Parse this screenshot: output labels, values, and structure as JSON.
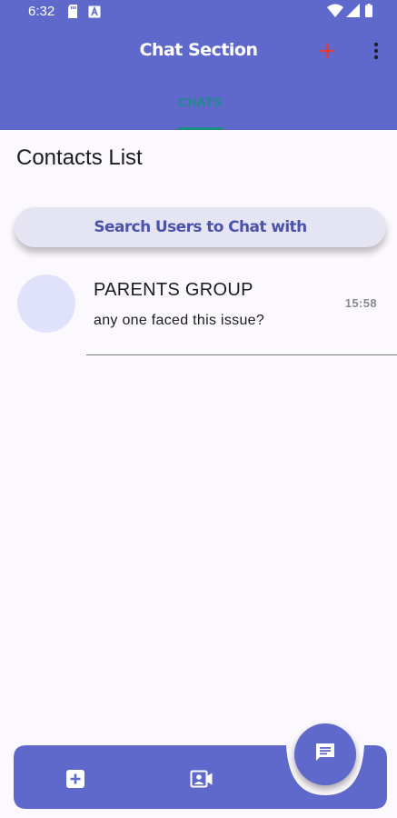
{
  "status_bar": {
    "time": "6:32",
    "icons": [
      "sd-card-icon",
      "keyboard-a-icon",
      "wifi-icon",
      "signal-icon",
      "battery-icon"
    ]
  },
  "app_bar": {
    "title": "Chat Section",
    "actions": [
      "add-icon",
      "more-vert-icon"
    ],
    "add_icon_color": "#e53935"
  },
  "tabs": [
    {
      "label": "CHATS",
      "selected": true
    }
  ],
  "section_title": "Contacts List",
  "search_button": {
    "label": "Search Users to Chat with"
  },
  "chats": [
    {
      "name": "PARENTS GROUP",
      "last_message": "any one faced this issue?",
      "time": "15:58"
    }
  ],
  "bottom_nav": {
    "items": [
      "add-box-icon",
      "video-contact-icon"
    ],
    "fab_icon": "chat-message-icon"
  },
  "colors": {
    "primary": "#5f68cb",
    "accent": "#1c8d86",
    "background": "#fcf9fe",
    "avatar": "#e0e2fb",
    "search_bg": "#e5e4f3",
    "search_text": "#4b53a8"
  }
}
